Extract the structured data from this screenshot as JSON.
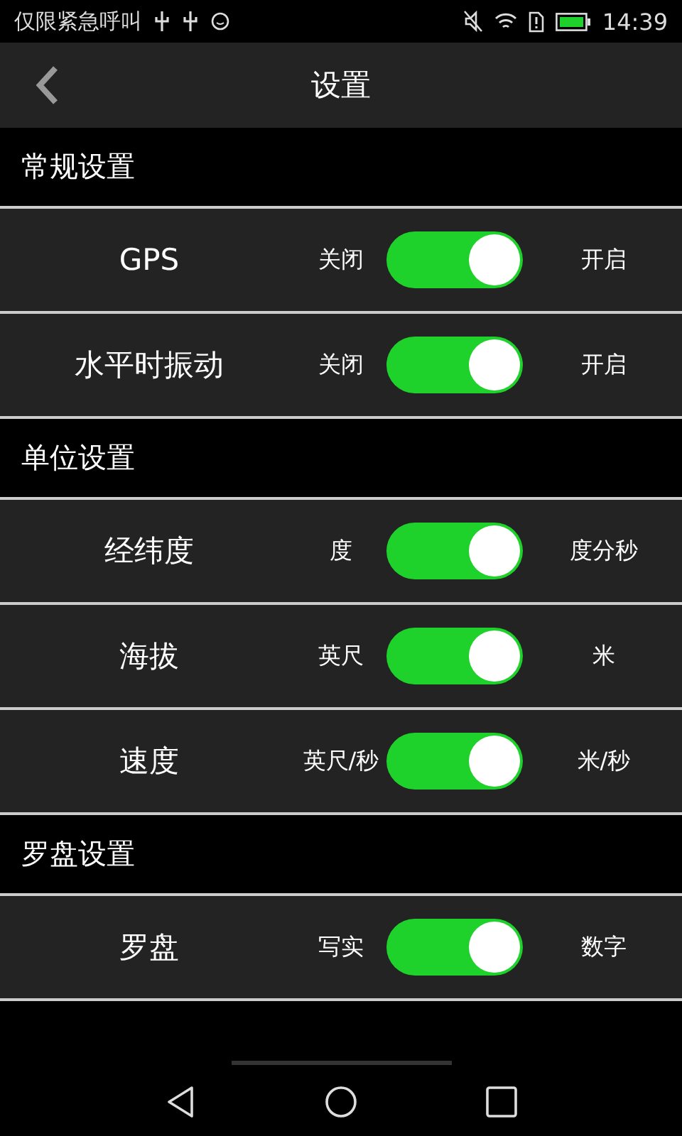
{
  "status_bar": {
    "carrier": "仅限紧急呼叫",
    "time": "14:39"
  },
  "header": {
    "title": "设置"
  },
  "sections": [
    {
      "title": "常规设置",
      "rows": [
        {
          "label": "GPS",
          "off_label": "关闭",
          "on_label": "开启",
          "on": true
        },
        {
          "label": "水平时振动",
          "off_label": "关闭",
          "on_label": "开启",
          "on": true
        }
      ]
    },
    {
      "title": "单位设置",
      "rows": [
        {
          "label": "经纬度",
          "off_label": "度",
          "on_label": "度分秒",
          "on": true
        },
        {
          "label": "海拔",
          "off_label": "英尺",
          "on_label": "米",
          "on": true
        },
        {
          "label": "速度",
          "off_label": "英尺/秒",
          "on_label": "米/秒",
          "on": true
        }
      ]
    },
    {
      "title": "罗盘设置",
      "rows": [
        {
          "label": "罗盘",
          "off_label": "写实",
          "on_label": "数字",
          "on": true
        }
      ]
    }
  ]
}
